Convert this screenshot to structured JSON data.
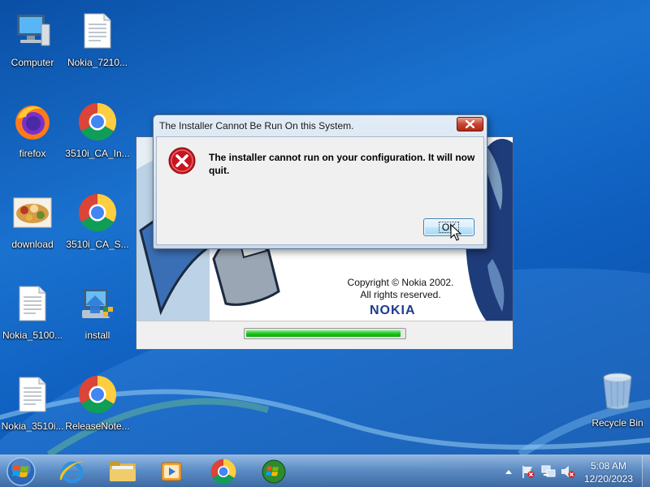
{
  "desktop": {
    "icons": [
      {
        "label": "Computer",
        "icon": "computer-icon"
      },
      {
        "label": "Nokia_7210...",
        "icon": "text-file-icon"
      },
      {
        "label": "firefox",
        "icon": "firefox-icon"
      },
      {
        "label": "3510i_CA_In...",
        "icon": "chrome-icon"
      },
      {
        "label": "download",
        "icon": "image-file-icon"
      },
      {
        "label": "3510i_CA_S...",
        "icon": "chrome-icon"
      },
      {
        "label": "Nokia_5100...",
        "icon": "text-file-icon"
      },
      {
        "label": "install",
        "icon": "installer-icon"
      },
      {
        "label": "Nokia_3510i...",
        "icon": "text-file-icon"
      },
      {
        "label": "ReleaseNote...",
        "icon": "chrome-icon"
      },
      {
        "label": "Recycle Bin",
        "icon": "recycle-bin-icon"
      }
    ]
  },
  "installer": {
    "copyright": "Copyright © Nokia 2002.",
    "rights": "All rights reserved.",
    "brand": "NOKIA",
    "progress": 0.98
  },
  "dialog": {
    "title": "The Installer Cannot Be Run On this System.",
    "message": "The installer cannot run on your configuration. It will now quit.",
    "ok_label": "OK",
    "icon": "error-icon"
  },
  "taskbar": {
    "buttons": [
      "start-button",
      "internet-explorer",
      "windows-explorer",
      "media-player",
      "chrome",
      "windows-installer"
    ],
    "tray_icons": [
      "show-hidden-icons-arrow",
      "action-center-flag-icon",
      "network-icon",
      "volume-muted-icon"
    ],
    "time": "5:08 AM",
    "date": "12/20/2023"
  },
  "colors": {
    "desktop_blue": "#1a72cf",
    "error_red": "#c8141e",
    "nokia_blue": "#1b3c8f",
    "progress_green": "#17c317"
  }
}
